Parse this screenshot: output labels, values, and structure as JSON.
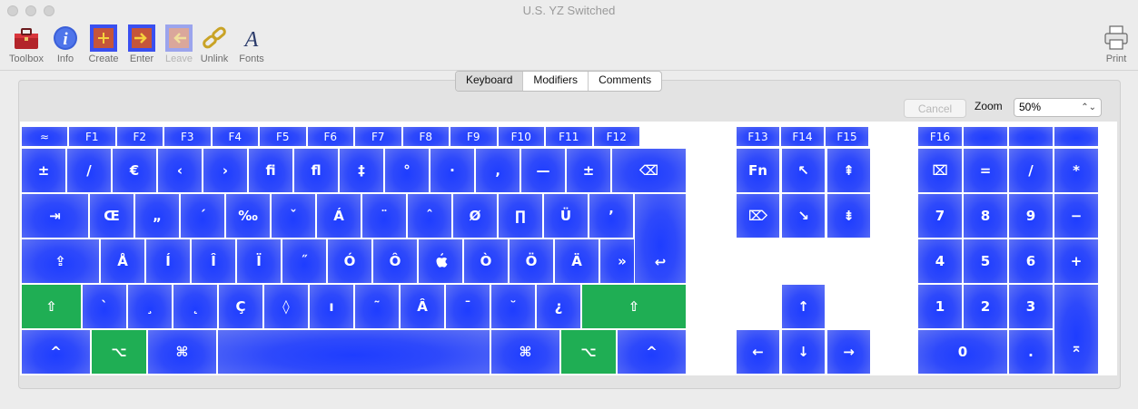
{
  "window": {
    "title": "U.S. YZ Switched"
  },
  "toolbar": {
    "toolbox": "Toolbox",
    "info": "Info",
    "create": "Create",
    "enter": "Enter",
    "leave": "Leave",
    "unlink": "Unlink",
    "fonts": "Fonts",
    "print": "Print"
  },
  "tabs": {
    "keyboard": "Keyboard",
    "modifiers": "Modifiers",
    "comments": "Comments",
    "selected": "Keyboard"
  },
  "controls": {
    "cancel": "Cancel",
    "zoom_label": "Zoom",
    "zoom_value": "50%"
  },
  "keys": {
    "fn_row": [
      "≈",
      "F1",
      "F2",
      "F3",
      "F4",
      "F5",
      "F6",
      "F7",
      "F8",
      "F9",
      "F10",
      "F11",
      "F12"
    ],
    "fn_right": [
      "F13",
      "F14",
      "F15"
    ],
    "f16": "F16",
    "row1": [
      "±",
      "/",
      "€",
      "‹",
      "›",
      "ﬁ",
      "ﬂ",
      "‡",
      "°",
      "·",
      "‚",
      "—",
      "±",
      "⌫"
    ],
    "row2": [
      "⇥",
      "Œ",
      "„",
      "´",
      "‰",
      "ˇ",
      "Á",
      "¨",
      "ˆ",
      "Ø",
      "∏",
      "Ü",
      "’"
    ],
    "row3": [
      "⇪",
      "Å",
      "Í",
      "Î",
      "Ï",
      "˝",
      "Ó",
      "Ô",
      "",
      "Ò",
      "Ö",
      "Ä",
      "»",
      "↩"
    ],
    "row4": [
      "⇧",
      "`",
      "¸",
      "˛",
      "Ç",
      "◊",
      "ı",
      "˜",
      "Â",
      "¯",
      "˘",
      "¿",
      "⇧"
    ],
    "row5": [
      "^",
      "⌥",
      "⌘",
      "",
      "⌘",
      "⌥",
      "^"
    ],
    "nav": [
      "Fn",
      "↖",
      "⇞",
      "⌦",
      "↘",
      "⇟"
    ],
    "arrows": [
      "↑",
      "←",
      "↓",
      "→"
    ],
    "numpad": [
      "⌧",
      "=",
      "/",
      "*",
      "7",
      "8",
      "9",
      "−",
      "4",
      "5",
      "6",
      "+",
      "1",
      "2",
      "3",
      "0",
      ".",
      "⌅"
    ]
  }
}
